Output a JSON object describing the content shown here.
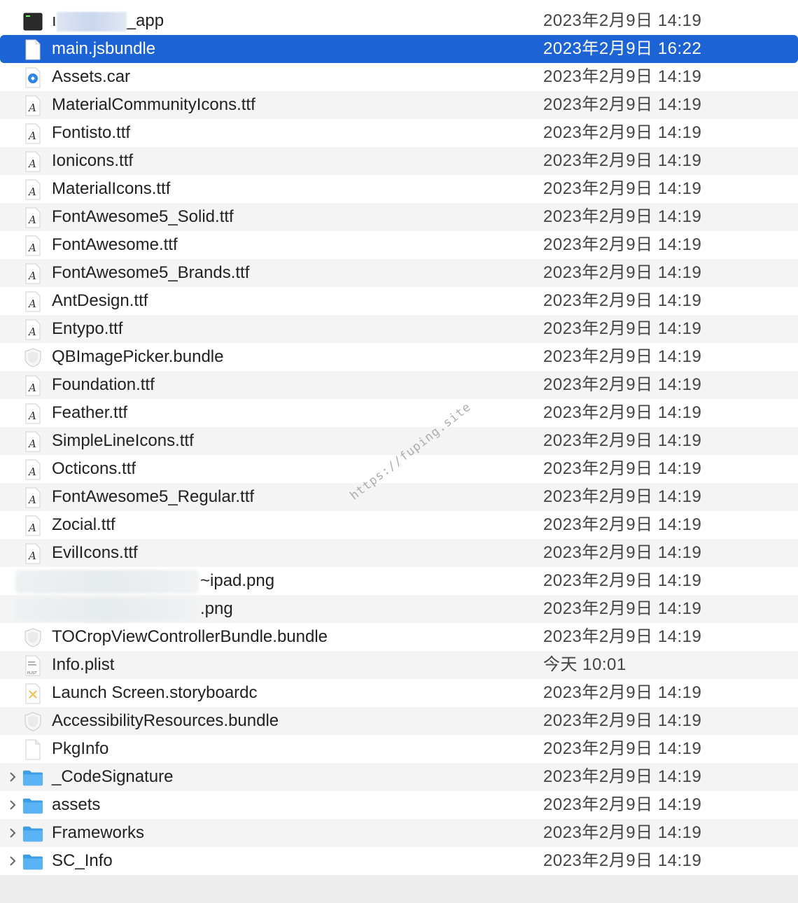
{
  "rows": [
    {
      "name_suffix": "_app",
      "date": "2023年2月9日 14:19",
      "icon": "terminal-app-icon"
    },
    {
      "name": "main.jsbundle",
      "date": "2023年2月9日 16:22",
      "icon": "document-icon",
      "selected": true
    },
    {
      "name": "Assets.car",
      "date": "2023年2月9日 14:19",
      "icon": "asset-catalog-icon"
    },
    {
      "name": "MaterialCommunityIcons.ttf",
      "date": "2023年2月9日 14:19",
      "icon": "font-file-icon"
    },
    {
      "name": "Fontisto.ttf",
      "date": "2023年2月9日 14:19",
      "icon": "font-file-icon"
    },
    {
      "name": "Ionicons.ttf",
      "date": "2023年2月9日 14:19",
      "icon": "font-file-icon"
    },
    {
      "name": "MaterialIcons.ttf",
      "date": "2023年2月9日 14:19",
      "icon": "font-file-icon"
    },
    {
      "name": "FontAwesome5_Solid.ttf",
      "date": "2023年2月9日 14:19",
      "icon": "font-file-icon"
    },
    {
      "name": "FontAwesome.ttf",
      "date": "2023年2月9日 14:19",
      "icon": "font-file-icon"
    },
    {
      "name": "FontAwesome5_Brands.ttf",
      "date": "2023年2月9日 14:19",
      "icon": "font-file-icon"
    },
    {
      "name": "AntDesign.ttf",
      "date": "2023年2月9日 14:19",
      "icon": "font-file-icon"
    },
    {
      "name": "Entypo.ttf",
      "date": "2023年2月9日 14:19",
      "icon": "font-file-icon"
    },
    {
      "name": "QBImagePicker.bundle",
      "date": "2023年2月9日 14:19",
      "icon": "bundle-icon"
    },
    {
      "name": "Foundation.ttf",
      "date": "2023年2月9日 14:19",
      "icon": "font-file-icon"
    },
    {
      "name": "Feather.ttf",
      "date": "2023年2月9日 14:19",
      "icon": "font-file-icon"
    },
    {
      "name": "SimpleLineIcons.ttf",
      "date": "2023年2月9日 14:19",
      "icon": "font-file-icon"
    },
    {
      "name": "Octicons.ttf",
      "date": "2023年2月9日 14:19",
      "icon": "font-file-icon"
    },
    {
      "name": "FontAwesome5_Regular.ttf",
      "date": "2023年2月9日 14:19",
      "icon": "font-file-icon"
    },
    {
      "name": "Zocial.ttf",
      "date": "2023年2月9日 14:19",
      "icon": "font-file-icon"
    },
    {
      "name": "EvilIcons.ttf",
      "date": "2023年2月9日 14:19",
      "icon": "font-file-icon"
    },
    {
      "name_suffix": "~ipad.png",
      "date": "2023年2月9日 14:19",
      "icon": "image-thumbnail-icon"
    },
    {
      "name_suffix": ".png",
      "date": "2023年2月9日 14:19",
      "icon": "image-thumbnail-icon"
    },
    {
      "name": "TOCropViewControllerBundle.bundle",
      "date": "2023年2月9日 14:19",
      "icon": "bundle-icon"
    },
    {
      "name": "Info.plist",
      "date": "今天 10:01",
      "icon": "plist-icon"
    },
    {
      "name": "Launch Screen.storyboardc",
      "date": "2023年2月9日 14:19",
      "icon": "storyboard-icon"
    },
    {
      "name": "AccessibilityResources.bundle",
      "date": "2023年2月9日 14:19",
      "icon": "bundle-icon"
    },
    {
      "name": "PkgInfo",
      "date": "2023年2月9日 14:19",
      "icon": "document-icon"
    },
    {
      "name": "_CodeSignature",
      "date": "2023年2月9日 14:19",
      "icon": "folder-icon",
      "folder": true
    },
    {
      "name": "assets",
      "date": "2023年2月9日 14:19",
      "icon": "folder-icon",
      "folder": true
    },
    {
      "name": "Frameworks",
      "date": "2023年2月9日 14:19",
      "icon": "folder-icon",
      "folder": true
    },
    {
      "name": "SC_Info",
      "date": "2023年2月9日 14:19",
      "icon": "folder-icon",
      "folder": true
    }
  ],
  "watermark": "https://fuping.site",
  "colors": {
    "selection": "#1c63d6",
    "folder": "#5ab3f2",
    "alt_row": "#f4f4f4"
  }
}
